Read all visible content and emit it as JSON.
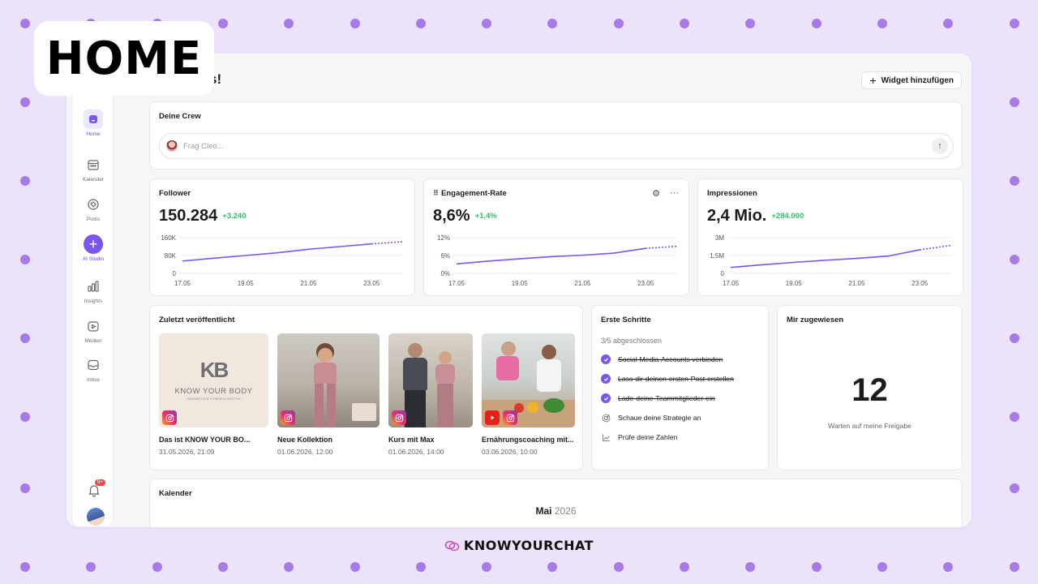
{
  "overlay_badge": "HOME",
  "greeting": "s!",
  "widget_button": "Widget hinzufügen",
  "sidebar": {
    "items": [
      {
        "label": "Home",
        "icon": "home-icon",
        "active": true
      },
      {
        "label": "Kalender",
        "icon": "calendar-icon"
      },
      {
        "label": "Posts",
        "icon": "posts-icon"
      },
      {
        "label": "AI Studio",
        "icon": "plus-icon"
      },
      {
        "label": "Insights",
        "icon": "bar-chart-icon"
      },
      {
        "label": "Medien",
        "icon": "media-icon"
      },
      {
        "label": "Inbox",
        "icon": "inbox-icon"
      }
    ],
    "notification_count": "9+"
  },
  "crew": {
    "title": "Deine Crew",
    "placeholder": "Frag Cleo..."
  },
  "metrics": [
    {
      "title": "Follower",
      "value": "150.284",
      "delta": "+3.240",
      "chart_data": {
        "type": "line",
        "x": [
          "17.05",
          "18.05",
          "19.05",
          "20.05",
          "21.05",
          "22.05",
          "23.05",
          "24.05"
        ],
        "values": [
          55000,
          68000,
          80000,
          92000,
          108000,
          120000,
          132000,
          142000
        ],
        "projected_from_index": 6,
        "yticks": [
          "160K",
          "80K",
          "0"
        ],
        "xticks": [
          "17.05",
          "19.05",
          "21.05",
          "23.05"
        ],
        "ylim": [
          0,
          160000
        ]
      }
    },
    {
      "title": "Engagement-Rate",
      "value": "8,6%",
      "delta": "+1,4%",
      "chart_data": {
        "type": "line",
        "x": [
          "17.05",
          "18.05",
          "19.05",
          "20.05",
          "21.05",
          "22.05",
          "23.05",
          "24.05"
        ],
        "values": [
          3.2,
          4.1,
          4.9,
          5.6,
          6.1,
          6.8,
          8.4,
          9.1
        ],
        "projected_from_index": 6,
        "yticks": [
          "12%",
          "6%",
          "0%"
        ],
        "xticks": [
          "17.05",
          "19.05",
          "21.05",
          "23.05"
        ],
        "ylim": [
          0,
          12
        ]
      }
    },
    {
      "title": "Impressionen",
      "value": "2,4 Mio.",
      "delta": "+284.000",
      "chart_data": {
        "type": "line",
        "x": [
          "17.05",
          "18.05",
          "19.05",
          "20.05",
          "21.05",
          "22.05",
          "23.05",
          "24.05"
        ],
        "values": [
          0.5,
          0.72,
          0.92,
          1.1,
          1.26,
          1.45,
          1.98,
          2.35
        ],
        "projected_from_index": 6,
        "yticks": [
          "3M",
          "1,5M",
          "0"
        ],
        "xticks": [
          "17.05",
          "19.05",
          "21.05",
          "23.05"
        ],
        "ylim": [
          0,
          3
        ]
      }
    }
  ],
  "recent": {
    "title": "Zuletzt veröffentlicht",
    "posts": [
      {
        "title": "Das ist KNOW YOUR BO...",
        "date": "31.05.2026, 21:09",
        "logo_main": "KNOW YOUR BODY",
        "logo_sub": "GANZHEITLICHE FITNESS & LIFESTYLE",
        "logo_mark": "KB"
      },
      {
        "title": "Neue Kollektion",
        "date": "01.06.2026, 12:00"
      },
      {
        "title": "Kurs mit Max",
        "date": "01.06.2026, 14:00"
      },
      {
        "title": "Ernährungscoaching mit...",
        "date": "03.06.2026, 10:00"
      }
    ]
  },
  "steps": {
    "title": "Erste Schritte",
    "progress": "3/5 abgeschlossen",
    "items": [
      {
        "label": "Social-Media-Accounts verbinden",
        "done": true
      },
      {
        "label": "Lass-dir-deinen-ersten-Post-erstellen",
        "done": true
      },
      {
        "label": "Lade-deine-Teammitglieder-ein",
        "done": true
      },
      {
        "label": "Schaue deine Strategie an",
        "done": false
      },
      {
        "label": "Prüfe deine Zahlen",
        "done": false
      }
    ]
  },
  "assigned": {
    "title": "Mir zugewiesen",
    "count": "12",
    "caption": "Warten auf meine Freigabe"
  },
  "calendar": {
    "title": "Kalender",
    "month": "Mai",
    "year": "2026"
  },
  "footer_brand": "KNOWYOURCHAT",
  "colors": {
    "background": "#ece3fb",
    "dots": "#a67be8",
    "accent": "#7a55f0",
    "positive": "#2fbf6a"
  }
}
